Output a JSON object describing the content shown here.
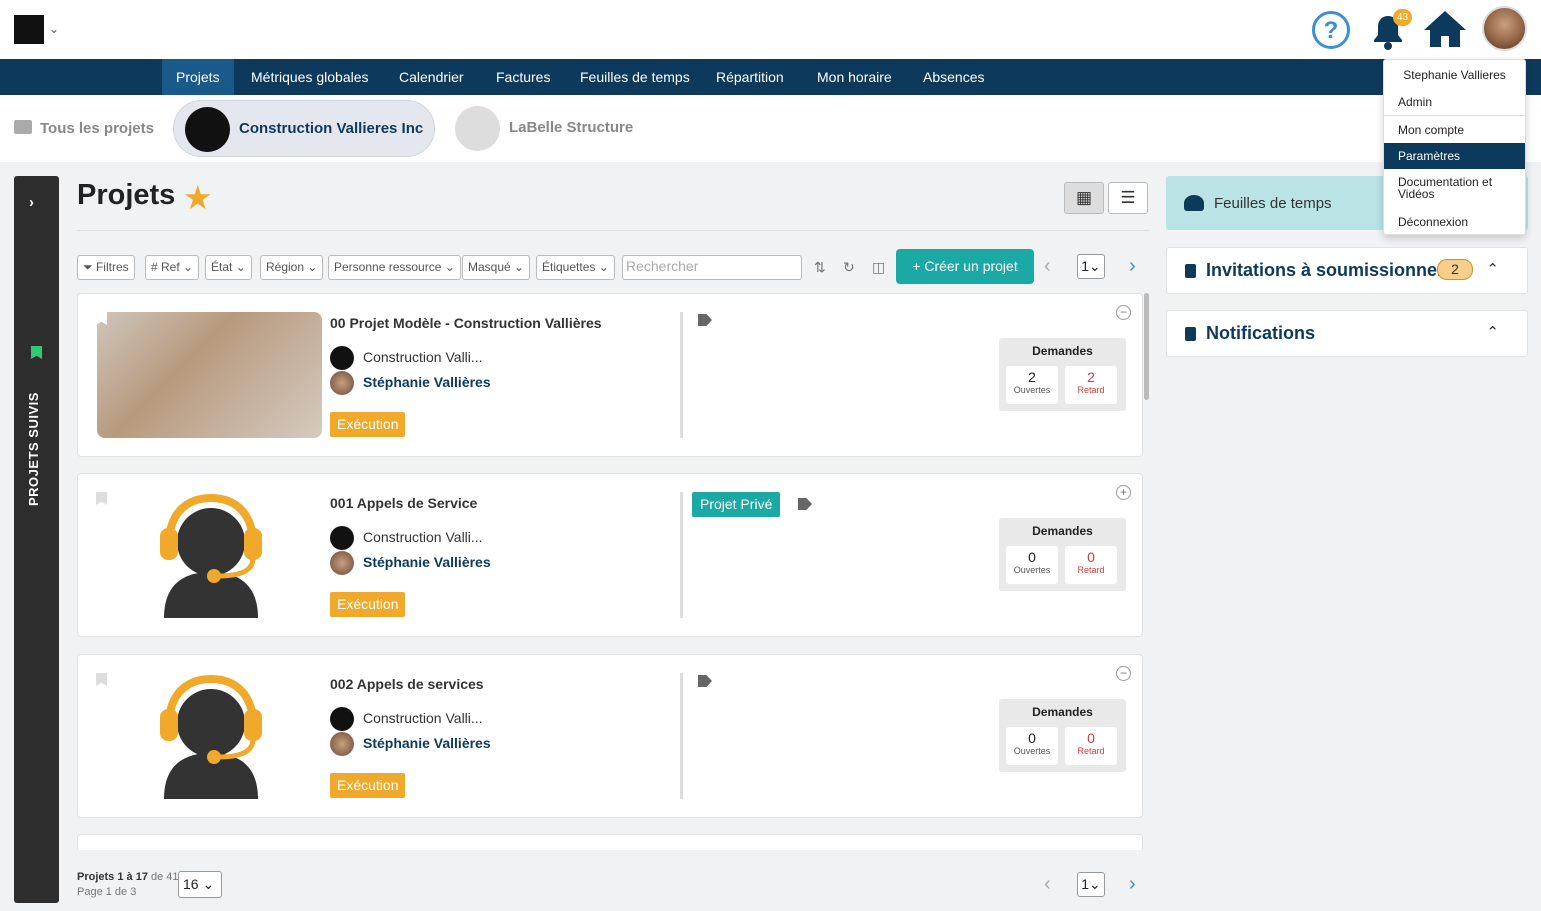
{
  "header": {
    "notifications_count": "43",
    "help_icon": "?"
  },
  "nav": {
    "items": [
      "Projets",
      "Métriques globales",
      "Calendrier",
      "Factures",
      "Feuilles de temps",
      "Répartition",
      "Mon horaire",
      "Absences"
    ]
  },
  "projects_bar": {
    "all": "Tous les projets",
    "active": "Construction Vallieres Inc",
    "other": "LaBelle Structure"
  },
  "sidebar": {
    "followed": "PROJETS SUIVIS"
  },
  "main": {
    "title": "Projets",
    "filters": {
      "filtres": "Filtres",
      "ref": "# Ref",
      "etat": "État",
      "region": "Région",
      "personne": "Personne ressource",
      "masque": "Masqué",
      "etiquettes": "Étiquettes"
    },
    "search_placeholder": "Rechercher",
    "create_button": "+ Créer un projet",
    "page_current": "1",
    "cards": [
      {
        "name": "00 Projet Modèle - Construction Vallières",
        "company": "Construction Valli...",
        "user": "Stéphanie Vallières",
        "state": "Exécution",
        "private": "",
        "demandes_title": "Demandes",
        "open": "2",
        "open_label": "Ouvertes",
        "late": "2",
        "late_label": "Retard",
        "toggle": "−"
      },
      {
        "name": "001 Appels de Service",
        "company": "Construction Valli...",
        "user": "Stéphanie Vallières",
        "state": "Exécution",
        "private": "Projet Privé",
        "demandes_title": "Demandes",
        "open": "0",
        "open_label": "Ouvertes",
        "late": "0",
        "late_label": "Retard",
        "toggle": "+"
      },
      {
        "name": "002 Appels de services",
        "company": "Construction Valli...",
        "user": "Stéphanie Vallières",
        "state": "Exécution",
        "private": "",
        "demandes_title": "Demandes",
        "open": "0",
        "open_label": "Ouvertes",
        "late": "0",
        "late_label": "Retard",
        "toggle": "−"
      }
    ],
    "pagination": {
      "range": "Projets 1 à 17",
      "total": "de 41",
      "page": "Page 1 de 3",
      "per_page": "16",
      "current": "1"
    }
  },
  "right_panel": {
    "timesheets": "Feuilles de temps",
    "invitations": "Invitations à soumissionner",
    "invitations_count": "2",
    "notifications": "Notifications"
  },
  "user_menu": {
    "name": "Stephanie Vallieres",
    "role": "Admin",
    "items": [
      "Mon compte",
      "Paramètres",
      "Documentation et Vidéos",
      "Déconnexion"
    ]
  },
  "colors": {
    "nav": "#0d3a5c",
    "accent": "#1ba9a6",
    "state": "#f0a92a",
    "late": "#d83a3a"
  }
}
